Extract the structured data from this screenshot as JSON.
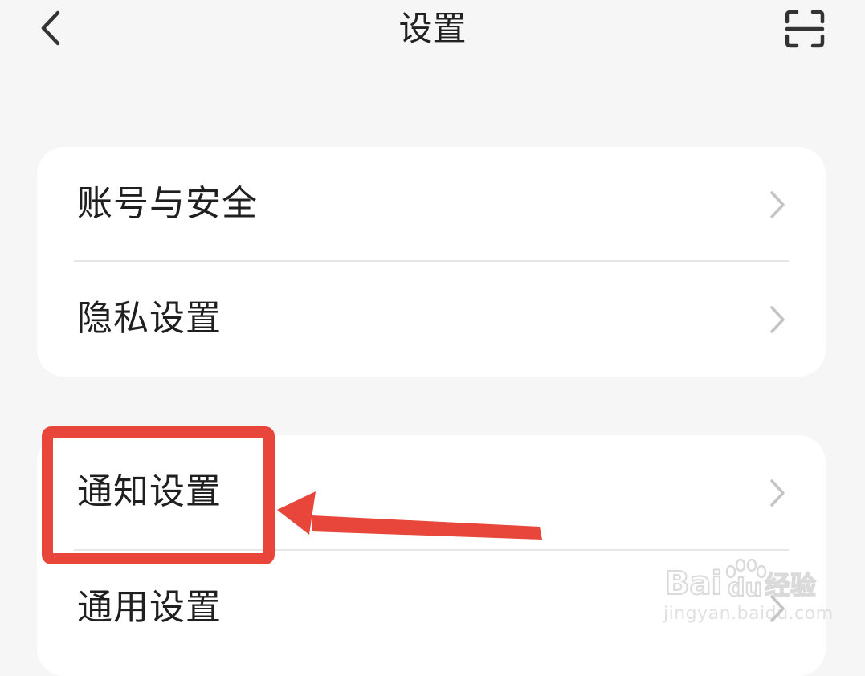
{
  "header": {
    "title": "设置",
    "back_icon": "chevron-left-icon",
    "scan_icon": "scan-frame-icon"
  },
  "sections": [
    {
      "items": [
        {
          "label": "账号与安全",
          "icon": "chevron-right-icon"
        },
        {
          "label": "隐私设置",
          "icon": "chevron-right-icon"
        }
      ]
    },
    {
      "items": [
        {
          "label": "通知设置",
          "icon": "chevron-right-icon",
          "highlighted": true
        },
        {
          "label": "通用设置",
          "icon": "chevron-right-icon"
        }
      ]
    }
  ],
  "annotation": {
    "highlight_color": "#e8463a",
    "target": "通知设置"
  },
  "watermark": {
    "logo_text": "Bai du 经验",
    "url": "jingyan.baidu.com"
  },
  "colors": {
    "background": "#f6f6f6",
    "card": "#ffffff",
    "divider": "#e6e6e6",
    "chevron": "#c4c4c4",
    "text": "#1f1f1f"
  }
}
